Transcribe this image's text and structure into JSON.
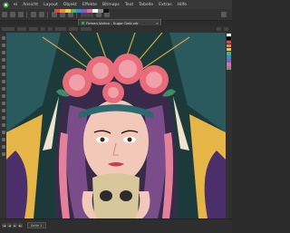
{
  "menu": {
    "items": [
      "ei",
      "Ansicht",
      "Layout",
      "Objekt",
      "Effekte",
      "Bitmaps",
      "Text",
      "Tabelle",
      "Extras",
      "Hilfe"
    ]
  },
  "document": {
    "tab_title": "Firmen-Vorlon - Sugar Gott.cdr",
    "close_glyph": "×"
  },
  "statusbar": {
    "page_label": "Seite 1",
    "nav_first": "|◀",
    "nav_prev": "◀",
    "nav_next": "▶",
    "nav_last": "▶|"
  },
  "palette": [
    "#e04848",
    "#ef8a3a",
    "#f2c94c",
    "#4fb36a",
    "#2f8fd1",
    "#8a5ac8",
    "#e26aa8",
    "#ffffff",
    "#888888",
    "#111111"
  ],
  "colors": {
    "bg_teal": "#1d3a3a",
    "rose": "#e86c7a",
    "hair": "#3a2a4a",
    "skin": "#f2c8b8",
    "gold": "#d9a441",
    "skull": "#d7c79a"
  }
}
